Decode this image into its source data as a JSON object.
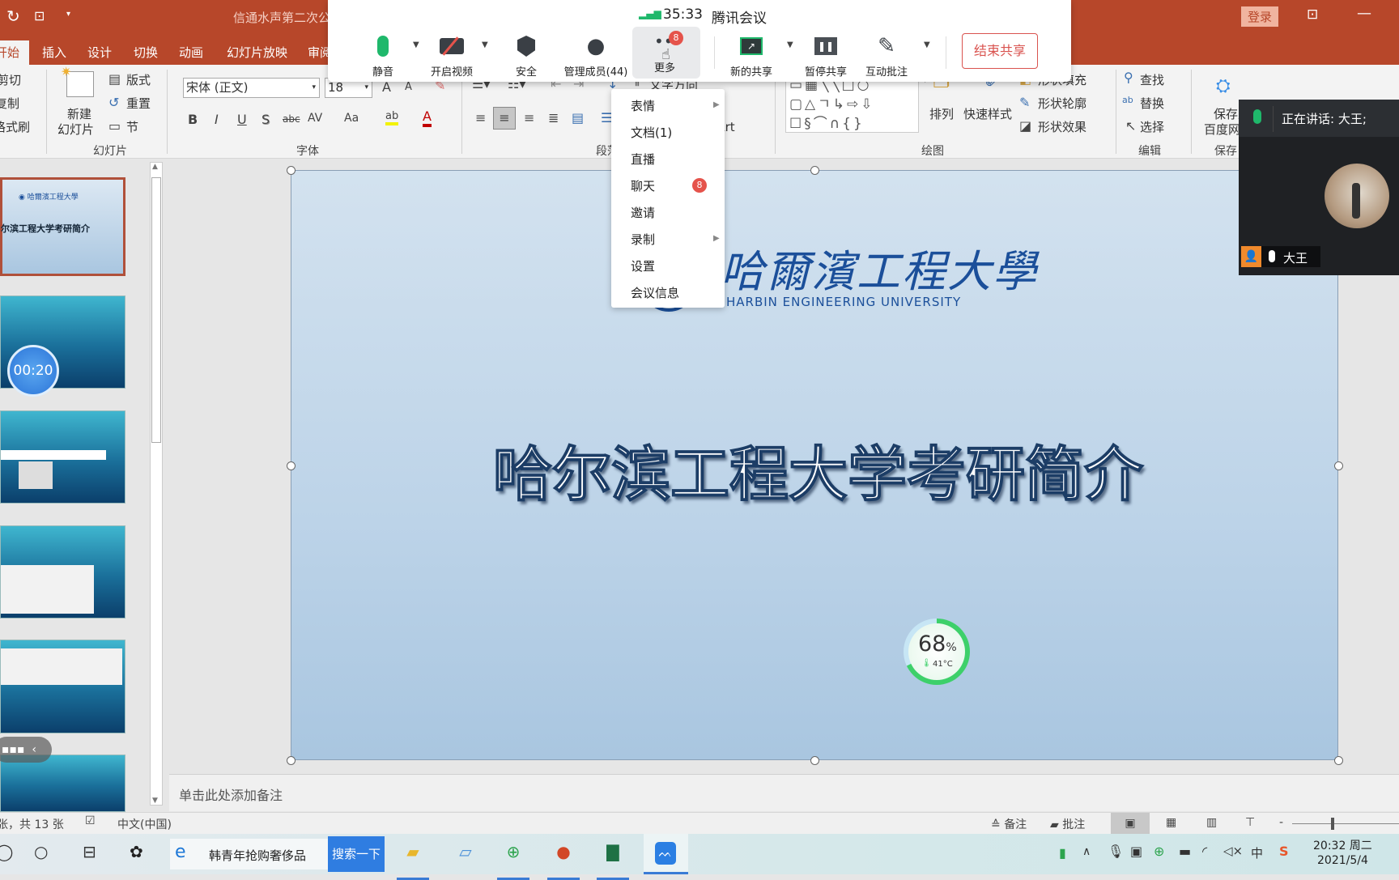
{
  "app": {
    "title": "信通水声第二次公",
    "login": "登录"
  },
  "tabs": [
    "开始",
    "插入",
    "设计",
    "切换",
    "动画",
    "幻灯片放映",
    "审阅"
  ],
  "ribbon": {
    "clipboard": [
      "剪切",
      "复制",
      "格式刷"
    ],
    "new_slide": [
      "新建",
      "幻灯片"
    ],
    "slides": [
      "版式",
      "重置",
      "节"
    ],
    "groups": {
      "slides": "幻灯片",
      "font": "字体",
      "paragraph": "段落",
      "drawing": "绘图",
      "editing": "编辑",
      "save": "保存"
    },
    "font_name": "宋体 (正文)",
    "font_size": "18",
    "font_buttons": [
      "B",
      "I",
      "U",
      "S",
      "abc",
      "AV",
      "Aa"
    ],
    "smartart": "SmartArt",
    "text_direction": "文字方向",
    "drawing": {
      "arrange": "排列",
      "quick_styles": "快速样式",
      "fill": "形状填充",
      "outline": "形状轮廓",
      "effects": "形状效果"
    },
    "editing": [
      "查找",
      "替换",
      "选择"
    ],
    "save_to": [
      "保存至",
      "百度网盘"
    ]
  },
  "meeting": {
    "timer": "35:33",
    "app_name": "腾讯会议",
    "buttons": {
      "mute": "静音",
      "video": "开启视频",
      "security": "安全",
      "members": "管理成员(44)",
      "more": "更多",
      "new_share": "新的共享",
      "pause_share": "暂停共享",
      "annotate": "互动批注"
    },
    "more_badge": "8",
    "end_share": "结束共享",
    "menu": [
      {
        "label": "表情",
        "submenu": true
      },
      {
        "label": "文档(1)"
      },
      {
        "label": "直播"
      },
      {
        "label": "聊天",
        "badge": "8"
      },
      {
        "label": "邀请"
      },
      {
        "label": "录制",
        "submenu": true
      },
      {
        "label": "设置"
      },
      {
        "label": "会议信息"
      }
    ],
    "speaking": "正在讲话: 大王;",
    "participant": "大王"
  },
  "slide": {
    "title": "哈尔滨工程大学考研简介",
    "logo_cn": "哈爾濱工程大學",
    "logo_en": "HARBIN ENGINEERING UNIVERSITY"
  },
  "thumbnails": {
    "timer": "00:20",
    "count": 6
  },
  "widget": {
    "cpu": "68",
    "unit": "%",
    "temp": "41°C"
  },
  "notes_placeholder": "单击此处添加备注",
  "status": {
    "slide_count": "张，共 13 张",
    "language": "中文(中国)",
    "notes": "备注",
    "comments": "批注"
  },
  "taskbar": {
    "news": "韩青年抢购奢侈品",
    "search": "搜索一下",
    "time": "20:32 周二",
    "date": "2021/5/4",
    "ime": "中"
  },
  "colors": {
    "accent": "#b7472a",
    "meeting_green": "#1fb86b",
    "end_share": "#d9534f"
  }
}
